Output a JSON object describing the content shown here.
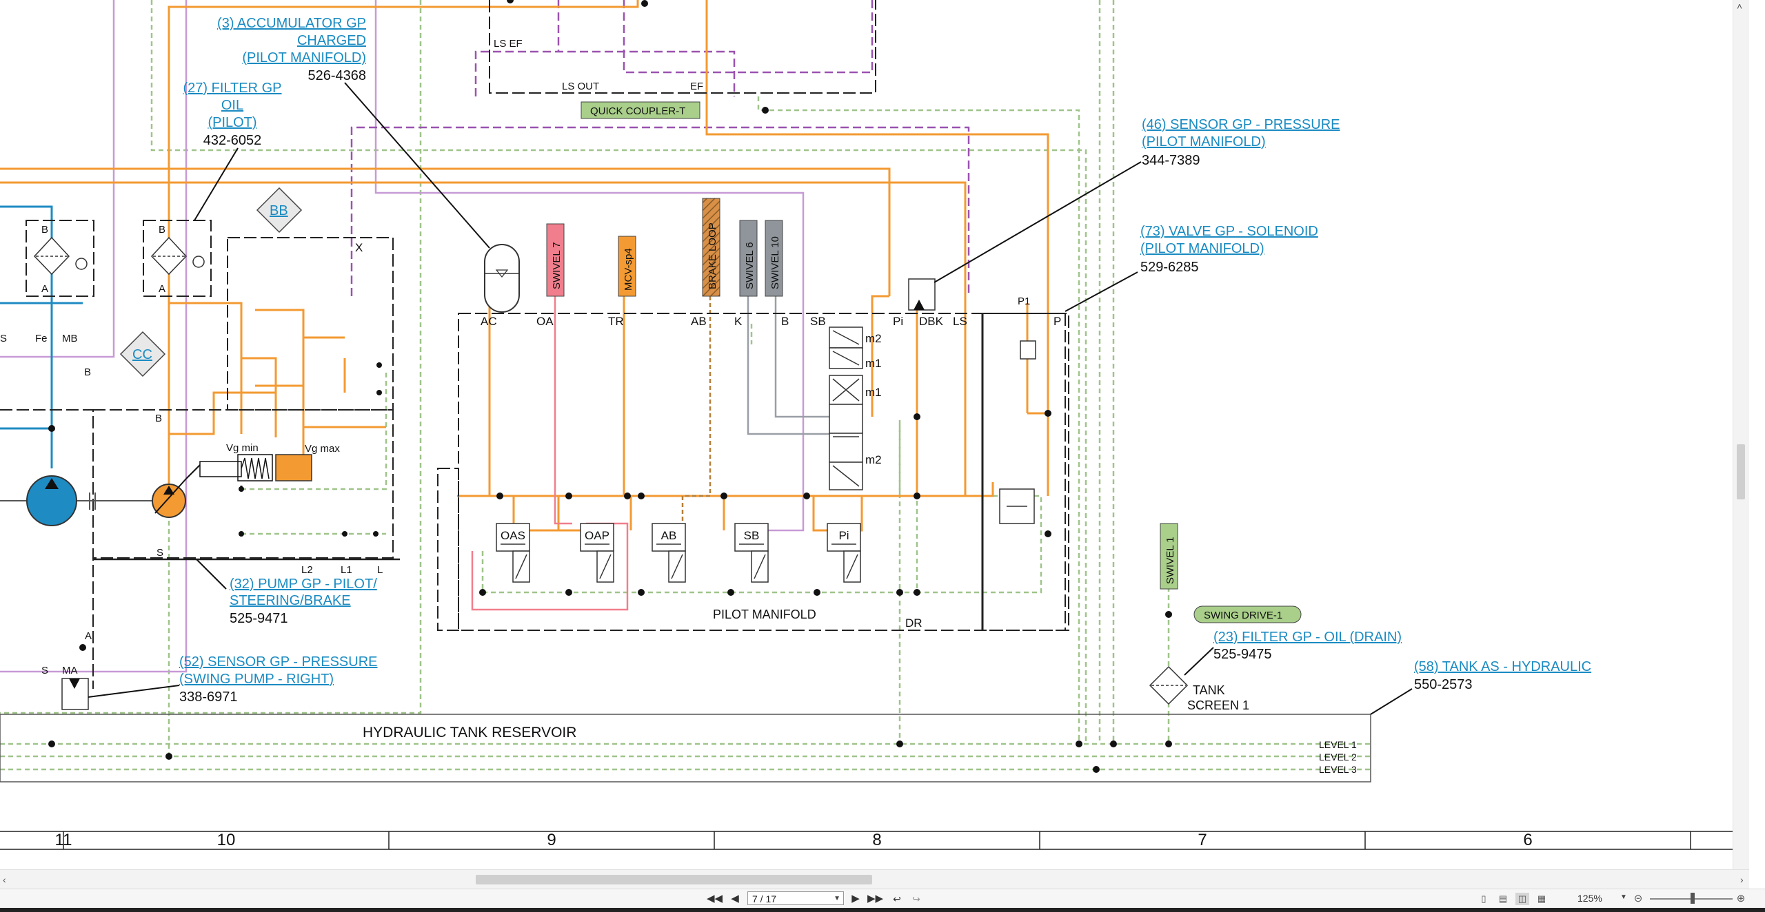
{
  "toolbar": {
    "page_value": "7 / 17",
    "zoom": "125%",
    "first_page_icon": "first-page-icon",
    "prev_page_icon": "previous-page-icon",
    "next_page_icon": "next-page-icon",
    "last_page_icon": "last-page-icon"
  },
  "callouts": [
    {
      "id": "c3",
      "lines": [
        "(3) ACCUMULATOR GP",
        "CHARGED",
        "(PILOT MANIFOLD)"
      ],
      "part": "526-4368"
    },
    {
      "id": "c27",
      "lines": [
        "(27) FILTER GP",
        "OIL",
        "(PILOT)"
      ],
      "part": "432-6052"
    },
    {
      "id": "c46",
      "lines": [
        "(46) SENSOR GP - PRESSURE",
        "(PILOT MANIFOLD)"
      ],
      "part": "344-7389"
    },
    {
      "id": "c73",
      "lines": [
        "(73) VALVE GP - SOLENOID",
        "(PILOT MANIFOLD)"
      ],
      "part": "529-6285"
    },
    {
      "id": "c32",
      "lines": [
        "(32) PUMP GP - PILOT/",
        "STEERING/BRAKE"
      ],
      "part": "525-9471"
    },
    {
      "id": "c52",
      "lines": [
        "(52) SENSOR GP - PRESSURE",
        "(SWING PUMP - RIGHT)"
      ],
      "part": "338-6971"
    },
    {
      "id": "c23",
      "lines": [
        "(23) FILTER GP - OIL (DRAIN)"
      ],
      "part": "525-9475"
    },
    {
      "id": "c58",
      "lines": [
        "(58) TANK AS - HYDRAULIC"
      ],
      "part": "550-2573"
    }
  ],
  "tags": {
    "swivel7": "SWIVEL 7",
    "mcv": "MCV-sp4",
    "brake": "BRAKE LOOP",
    "swivel6": "SWIVEL 6",
    "swivel10": "SWIVEL 10",
    "swivel1": "SWIVEL 1",
    "quick_coupler": "QUICK COUPLER-T",
    "swing_drive": "SWING DRIVE-1",
    "bb": "BB",
    "cc": "CC"
  },
  "labels": {
    "pilot_manifold": "PILOT MANIFOLD",
    "tank_reservoir": "HYDRAULIC TANK RESERVOIR",
    "tank_screen": [
      "TANK",
      "SCREEN 1"
    ],
    "levels": [
      "LEVEL 1",
      "LEVEL 2",
      "LEVEL 3"
    ],
    "ports_top": [
      "AC",
      "OA",
      "TR",
      "AB",
      "K",
      "B",
      "SB",
      "Pi",
      "DBK",
      "LS",
      "P"
    ],
    "p1": "P1",
    "dr": "DR",
    "ls_ef": "LS EF",
    "ls_out": "LS OUT",
    "ef": "EF",
    "valves": [
      "OAS",
      "OAP",
      "AB",
      "SB",
      "Pi"
    ],
    "m_labels": [
      "m2",
      "m1",
      "m1",
      "m2"
    ],
    "left_ports": [
      "S",
      "Fe",
      "MB",
      "B",
      "A",
      "B",
      "A",
      "B",
      "X"
    ],
    "pump_ports": [
      "S",
      "L2",
      "L1",
      "L"
    ],
    "sensor_ports": [
      "A",
      "S",
      "MA"
    ],
    "vg_min": "Vg min",
    "vg_max": "Vg max"
  },
  "grid_columns": [
    "11",
    "10",
    "9",
    "8",
    "7",
    "6"
  ]
}
